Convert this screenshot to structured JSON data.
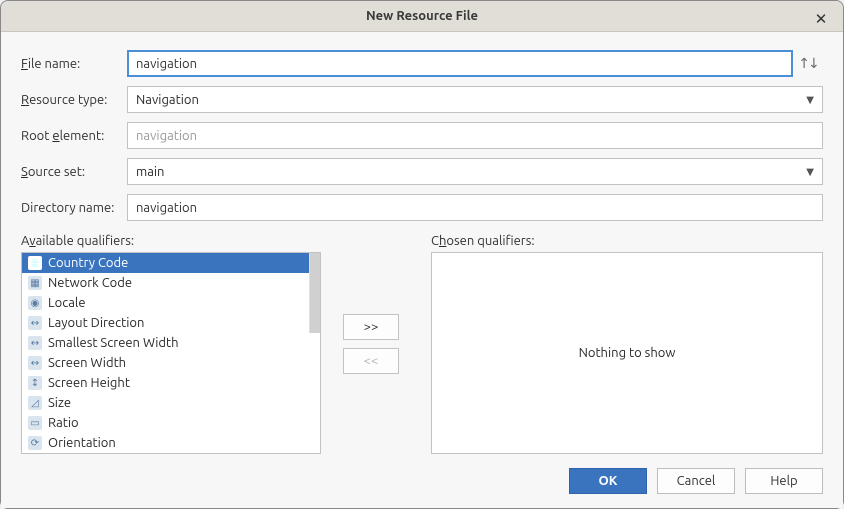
{
  "title": "New Resource File",
  "labels": {
    "file_name": "File name:",
    "resource_type": "Resource type:",
    "root_element": "Root element:",
    "source_set": "Source set:",
    "directory_name": "Directory name:",
    "available": "Available qualifiers:",
    "chosen": "Chosen qualifiers:"
  },
  "values": {
    "file_name": "navigation",
    "resource_type": "Navigation",
    "root_element": "navigation",
    "source_set": "main",
    "directory_name": "navigation"
  },
  "qualifiers": [
    "Country Code",
    "Network Code",
    "Locale",
    "Layout Direction",
    "Smallest Screen Width",
    "Screen Width",
    "Screen Height",
    "Size",
    "Ratio",
    "Orientation"
  ],
  "selected_qualifier_index": 0,
  "move": {
    "add": ">>",
    "remove": "<<"
  },
  "chosen_empty": "Nothing to show",
  "buttons": {
    "ok": "OK",
    "cancel": "Cancel",
    "help": "Help"
  }
}
